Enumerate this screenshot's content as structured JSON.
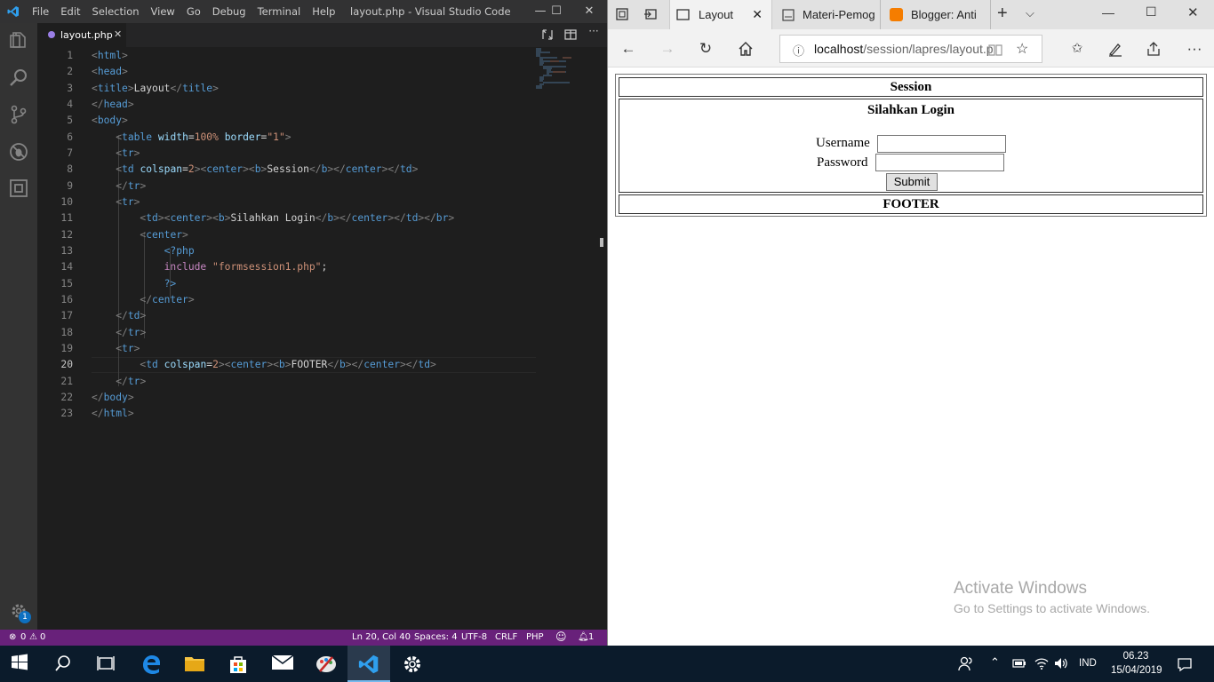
{
  "vscode": {
    "menu": [
      "File",
      "Edit",
      "Selection",
      "View",
      "Go",
      "Debug",
      "Terminal",
      "Help"
    ],
    "window_title": "layout.php - Visual Studio Code",
    "tab_label": "layout.php",
    "line_numbers": [
      "1",
      "2",
      "3",
      "4",
      "5",
      "6",
      "7",
      "8",
      "9",
      "10",
      "11",
      "12",
      "13",
      "14",
      "15",
      "16",
      "17",
      "18",
      "19",
      "20",
      "21",
      "22",
      "23"
    ],
    "status": {
      "problems": "0",
      "warnings": "0",
      "cursor": "Ln 20, Col 40",
      "spaces": "Spaces: 4",
      "encoding": "UTF-8",
      "eol": "CRLF",
      "language": "PHP",
      "notifications": "1"
    },
    "settings_badge": "1"
  },
  "edge": {
    "tabs": [
      {
        "label": "Layout",
        "icon": "page-icon"
      },
      {
        "label": "Materi-Pemog",
        "icon": "pdf-icon"
      },
      {
        "label": "Blogger: Anti",
        "icon": "blogger-icon"
      }
    ],
    "url_host": "localhost",
    "url_path": "/session/lapres/layout.p",
    "page": {
      "header": "Session",
      "login_title": "Silahkan Login",
      "username_label": "Username",
      "password_label": "Password",
      "submit_label": "Submit",
      "footer": "FOOTER"
    },
    "watermark_title": "Activate Windows",
    "watermark_sub": "Go to Settings to activate Windows."
  },
  "taskbar": {
    "language": "IND",
    "time": "06.23",
    "date": "15/04/2019"
  }
}
